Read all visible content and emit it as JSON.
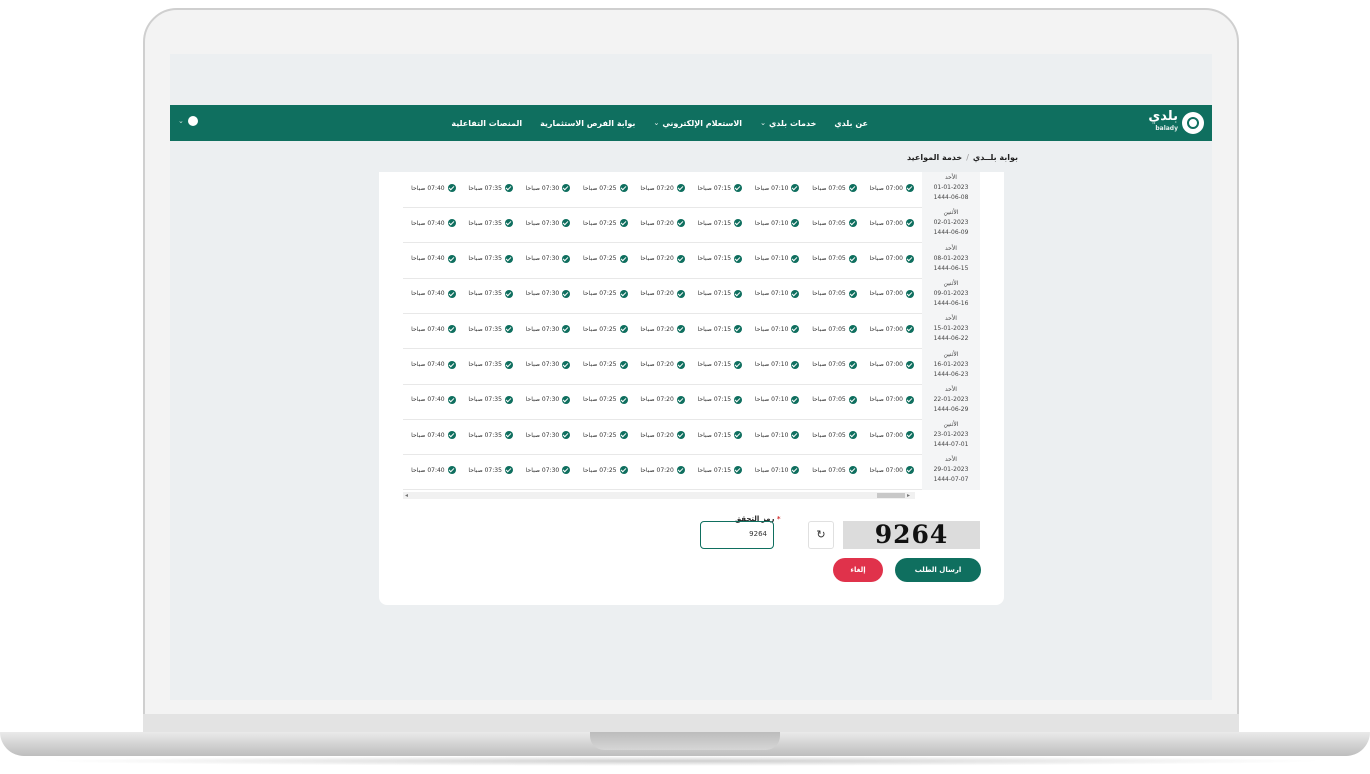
{
  "header": {
    "logo_text": "بلدي",
    "logo_sub": "balady",
    "menu": [
      {
        "label": "عن بلدي",
        "chevron": false
      },
      {
        "label": "خدمات بلدي",
        "chevron": true
      },
      {
        "label": "الاستعلام الإلكتروني",
        "chevron": true
      },
      {
        "label": "بوابة الفرص الاستثمارية",
        "chevron": false
      },
      {
        "label": "المنصات التفاعلية",
        "chevron": false
      }
    ]
  },
  "breadcrumb": {
    "home": "بوابة بلــدي",
    "current": "خدمة المواعيد",
    "sep": "/"
  },
  "slot_times": [
    "07:00 صباحا",
    "07:05 صباحا",
    "07:10 صباحا",
    "07:15 صباحا",
    "07:20 صباحا",
    "07:25 صباحا",
    "07:30 صباحا",
    "07:35 صباحا",
    "07:40 صباحا"
  ],
  "dates": [
    {
      "day": "الأحد",
      "greg": "01-01-2023",
      "hijri": "1444-06-08"
    },
    {
      "day": "الأثنين",
      "greg": "02-01-2023",
      "hijri": "1444-06-09"
    },
    {
      "day": "الأحد",
      "greg": "08-01-2023",
      "hijri": "1444-06-15"
    },
    {
      "day": "الأثنين",
      "greg": "09-01-2023",
      "hijri": "1444-06-16"
    },
    {
      "day": "الأحد",
      "greg": "15-01-2023",
      "hijri": "1444-06-22"
    },
    {
      "day": "الأثنين",
      "greg": "16-01-2023",
      "hijri": "1444-06-23"
    },
    {
      "day": "الأحد",
      "greg": "22-01-2023",
      "hijri": "1444-06-29"
    },
    {
      "day": "الأثنين",
      "greg": "23-01-2023",
      "hijri": "1444-07-01"
    },
    {
      "day": "الأحد",
      "greg": "29-01-2023",
      "hijri": "1444-07-07"
    }
  ],
  "captcha": {
    "label": "رمز التحقق",
    "required_mark": "*",
    "value": "9264",
    "image_text": "9264",
    "refresh_glyph": "↻"
  },
  "buttons": {
    "send": "ارسال الطلب",
    "cancel": "إلغاء"
  },
  "colors": {
    "primary": "#0f6f5f",
    "danger": "#e0324b"
  }
}
